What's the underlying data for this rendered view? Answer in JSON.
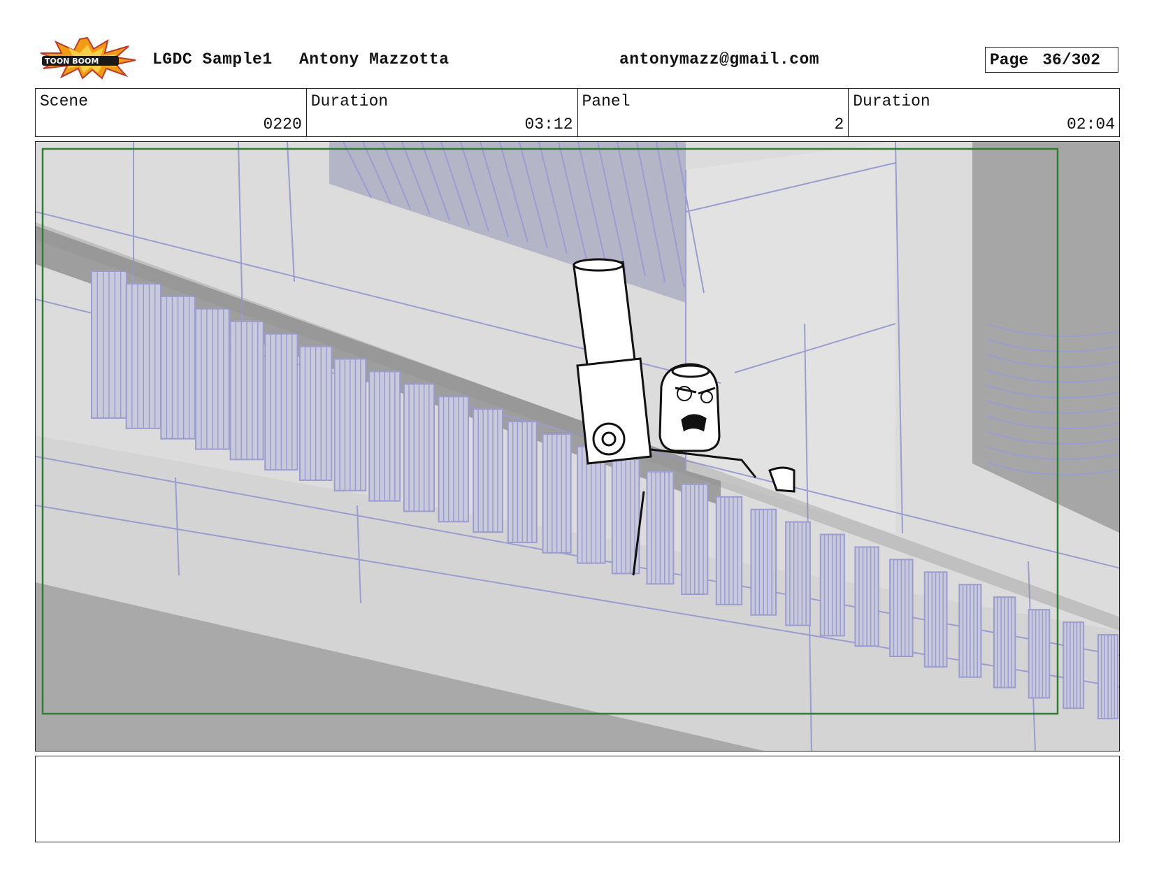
{
  "header": {
    "logo_icon": "toonboom-logo-icon",
    "logo_text": "TOON BOOM",
    "project": "LGDC Sample1",
    "author": "Antony Mazzotta",
    "email": "antonymazz@gmail.com",
    "page_label": "Page",
    "page_value": "36/302"
  },
  "info": {
    "scene_label": "Scene",
    "scene_value": "0220",
    "scene_duration_label": "Duration",
    "scene_duration_value": "03:12",
    "panel_label": "Panel",
    "panel_value": "2",
    "panel_duration_label": "Duration",
    "panel_duration_value": "02:04"
  },
  "panel_image": {
    "description_icon": "storyboard-panel-image",
    "safe_frame_color": "#2e7d32",
    "line_color": "#9b9ccf"
  },
  "notes": {
    "text": ""
  }
}
